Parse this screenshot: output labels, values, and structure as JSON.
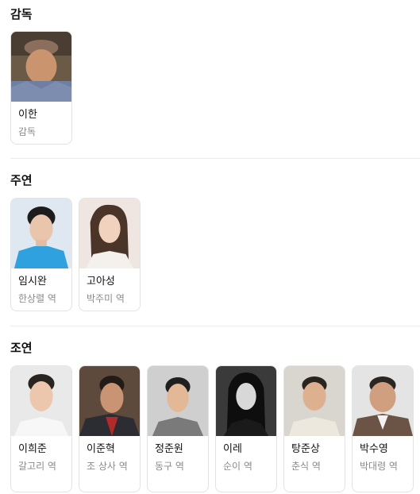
{
  "sections": [
    {
      "title": "감독",
      "people": [
        {
          "name": "이한",
          "role": "감독"
        }
      ]
    },
    {
      "title": "주연",
      "people": [
        {
          "name": "임시완",
          "role": "한상렬 역"
        },
        {
          "name": "고아성",
          "role": "박주미 역"
        }
      ]
    },
    {
      "title": "조연",
      "people": [
        {
          "name": "이희준",
          "role": "갈고리 역"
        },
        {
          "name": "이준혁",
          "role": "조 상사 역"
        },
        {
          "name": "정준원",
          "role": "동구 역"
        },
        {
          "name": "이레",
          "role": "순이 역"
        },
        {
          "name": "탕준상",
          "role": "춘식 역"
        },
        {
          "name": "박수영",
          "role": "박대령 역"
        }
      ]
    }
  ],
  "colors": {
    "border": "#e3e3e3",
    "role_text": "#8a8a8a",
    "divider": "#ececec"
  }
}
